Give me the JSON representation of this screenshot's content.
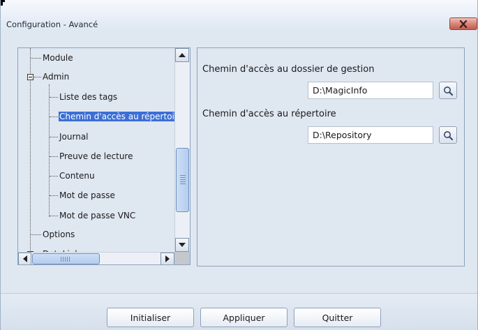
{
  "window": {
    "title": "Configuration - Avancé"
  },
  "tree": {
    "items": [
      {
        "label": "Module",
        "selected": false
      },
      {
        "label": "Admin",
        "selected": false,
        "expanded": true
      },
      {
        "label": "Liste des tags",
        "selected": false
      },
      {
        "label": "Chemin d'accès au répertoi",
        "selected": true
      },
      {
        "label": "Journal",
        "selected": false
      },
      {
        "label": "Preuve de lecture",
        "selected": false
      },
      {
        "label": "Contenu",
        "selected": false
      },
      {
        "label": "Mot de passe",
        "selected": false
      },
      {
        "label": "Mot de passe VNC",
        "selected": false
      },
      {
        "label": "Options",
        "selected": false
      },
      {
        "label": "DataLink",
        "selected": false
      }
    ]
  },
  "settings": {
    "management_folder_label": "Chemin d'accès au dossier de gestion",
    "management_folder_value": "D:\\MagicInfo",
    "repository_label": "Chemin d'accès au répertoire",
    "repository_value": "D:\\Repository"
  },
  "buttons": {
    "reset": "Initialiser",
    "apply": "Appliquer",
    "quit": "Quitter"
  },
  "colors": {
    "selection": "#3b6fd6",
    "window_bg": "#dfe7f1",
    "close_button": "#c25a4d"
  }
}
